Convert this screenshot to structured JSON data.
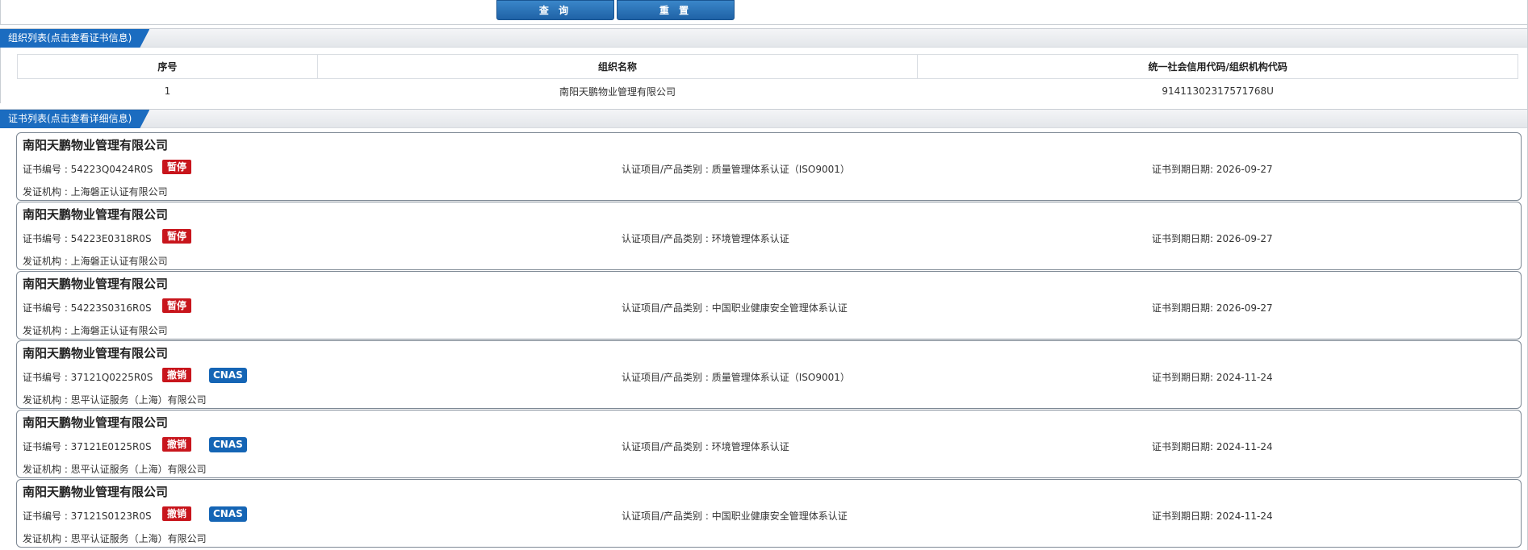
{
  "toolbar": {
    "query_label": "查 询",
    "reset_label": "重 置"
  },
  "org_section": {
    "title": "组织列表(点击查看证书信息)",
    "columns": [
      "序号",
      "组织名称",
      "统一社会信用代码/组织机构代码"
    ],
    "rows": [
      [
        "1",
        "南阳天鹏物业管理有限公司",
        "91411302317571768U"
      ]
    ]
  },
  "cert_section": {
    "title": "证书列表(点击查看详细信息)",
    "certs": [
      {
        "company": "南阳天鹏物业管理有限公司",
        "cert_no": "证书编号 : 54223Q0424R0S",
        "status": "暂停",
        "cnas": "",
        "category": "认证项目/产品类别 : 质量管理体系认证（ISO9001）",
        "expiry": "证书到期日期: 2026-09-27",
        "issuer": "发证机构 : 上海磐正认证有限公司"
      },
      {
        "company": "南阳天鹏物业管理有限公司",
        "cert_no": "证书编号 : 54223E0318R0S",
        "status": "暂停",
        "cnas": "",
        "category": "认证项目/产品类别 : 环境管理体系认证",
        "expiry": "证书到期日期: 2026-09-27",
        "issuer": "发证机构 : 上海磐正认证有限公司"
      },
      {
        "company": "南阳天鹏物业管理有限公司",
        "cert_no": "证书编号 : 54223S0316R0S",
        "status": "暂停",
        "cnas": "",
        "category": "认证项目/产品类别 : 中国职业健康安全管理体系认证",
        "expiry": "证书到期日期: 2026-09-27",
        "issuer": "发证机构 : 上海磐正认证有限公司"
      },
      {
        "company": "南阳天鹏物业管理有限公司",
        "cert_no": "证书编号 : 37121Q0225R0S",
        "status": "撤销",
        "cnas": "CNAS",
        "category": "认证项目/产品类别 : 质量管理体系认证（ISO9001）",
        "expiry": "证书到期日期: 2024-11-24",
        "issuer": "发证机构 : 思平认证服务（上海）有限公司"
      },
      {
        "company": "南阳天鹏物业管理有限公司",
        "cert_no": "证书编号 : 37121E0125R0S",
        "status": "撤销",
        "cnas": "CNAS",
        "category": "认证项目/产品类别 : 环境管理体系认证",
        "expiry": "证书到期日期: 2024-11-24",
        "issuer": "发证机构 : 思平认证服务（上海）有限公司"
      },
      {
        "company": "南阳天鹏物业管理有限公司",
        "cert_no": "证书编号 : 37121S0123R0S",
        "status": "撤销",
        "cnas": "CNAS",
        "category": "认证项目/产品类别 : 中国职业健康安全管理体系认证",
        "expiry": "证书到期日期: 2024-11-24",
        "issuer": "发证机构 : 思平认证服务（上海）有限公司"
      }
    ]
  },
  "colors": {
    "accent": "#1b6cc0",
    "status_red": "#c8151c",
    "cnas_blue": "#1565b5"
  }
}
